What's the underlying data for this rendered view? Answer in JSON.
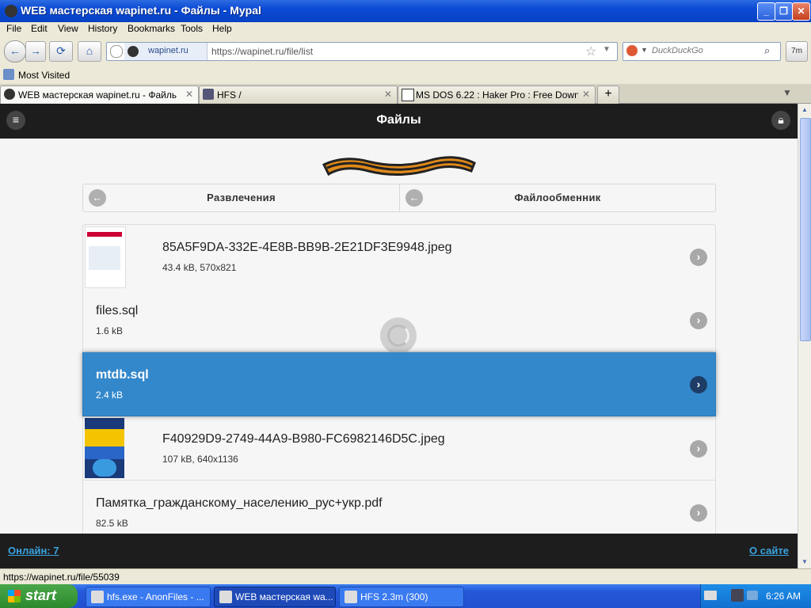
{
  "window": {
    "title": "WEB мастерская wapinet.ru - Файлы - Mypal"
  },
  "menu": [
    "File",
    "Edit",
    "View",
    "History",
    "Bookmarks",
    "Tools",
    "Help"
  ],
  "nav": {
    "site_label": "wapinet.ru",
    "url": "https://wapinet.ru/file/list",
    "search_placeholder": "DuckDuckGo",
    "addon_badge": "7m"
  },
  "bookmarks": {
    "most_visited": "Most Visited"
  },
  "tabs": [
    {
      "label": "WEB мастерская wapinet.ru - Файлы",
      "active": true
    },
    {
      "label": "HFS /",
      "active": false
    },
    {
      "label": "MS DOS 6.22 : Haker Pro : Free Downloa...",
      "active": false
    }
  ],
  "page": {
    "header_title": "Файлы",
    "categories": [
      "Развлечения",
      "Файлообменник"
    ],
    "files": [
      {
        "name": "85A5F9DA-332E-4E8B-BB9B-2E21DF3E9948.jpeg",
        "meta": "43.4 kB, 570x821",
        "has_thumb": true,
        "selected": false
      },
      {
        "name": "files.sql",
        "meta": "1.6 kB",
        "has_thumb": false,
        "selected": false
      },
      {
        "name": "mtdb.sql",
        "meta": "2.4 kB",
        "has_thumb": false,
        "selected": true
      },
      {
        "name": "F40929D9-2749-44A9-B980-FC6982146D5C.jpeg",
        "meta": "107 kB, 640x1136",
        "has_thumb": true,
        "selected": false
      },
      {
        "name": "Памятка_гражданскому_населению_рус+укр.pdf",
        "meta": "82.5 kB",
        "has_thumb": false,
        "selected": false
      }
    ],
    "footer_online": "Онлайн: 7",
    "footer_about": "О сайте"
  },
  "statusbar": {
    "text": "https://wapinet.ru/file/55039"
  },
  "taskbar": {
    "start_label": "start",
    "tasks": [
      {
        "label": "hfs.exe - AnonFiles - ..."
      },
      {
        "label": "WEB мастерская wa..."
      },
      {
        "label": "HFS 2.3m (300)"
      }
    ],
    "clock": "6:26 AM"
  },
  "colors": {
    "selected_row": "#3388cc",
    "header_bg": "#1d1d1d",
    "link": "#3aa3e0"
  }
}
